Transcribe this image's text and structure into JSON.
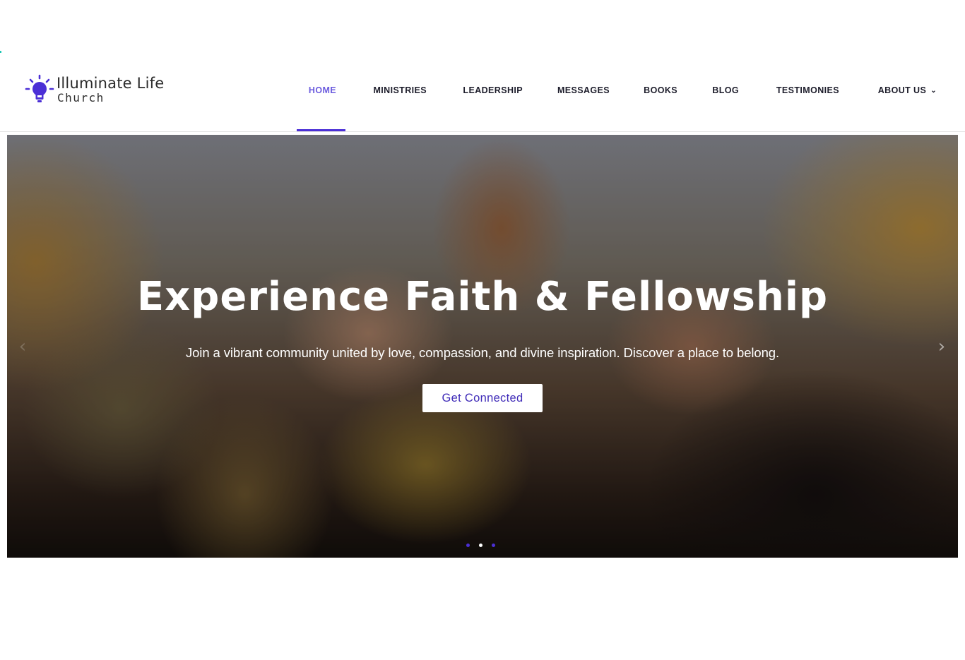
{
  "logo": {
    "line1": "Illuminate Life",
    "line2": "Church",
    "accent": "#4b2fd6"
  },
  "nav": {
    "items": [
      {
        "label": "HOME",
        "active": true
      },
      {
        "label": "MINISTRIES"
      },
      {
        "label": "LEADERSHIP"
      },
      {
        "label": "MESSAGES"
      },
      {
        "label": "BOOKS"
      },
      {
        "label": "BLOG"
      },
      {
        "label": "TESTIMONIES"
      },
      {
        "label": "ABOUT US",
        "dropdown": true
      }
    ],
    "active_color": "#6b5bde"
  },
  "hero": {
    "title": "Experience Faith & Fellowship",
    "subtitle": "Join a vibrant community united by love, compassion, and divine inspiration. Discover a place to belong.",
    "button": "Get Connected",
    "prev_icon": "chevron-left-icon",
    "next_icon": "chevron-right-icon",
    "slides": 3,
    "current_slide": 2
  }
}
